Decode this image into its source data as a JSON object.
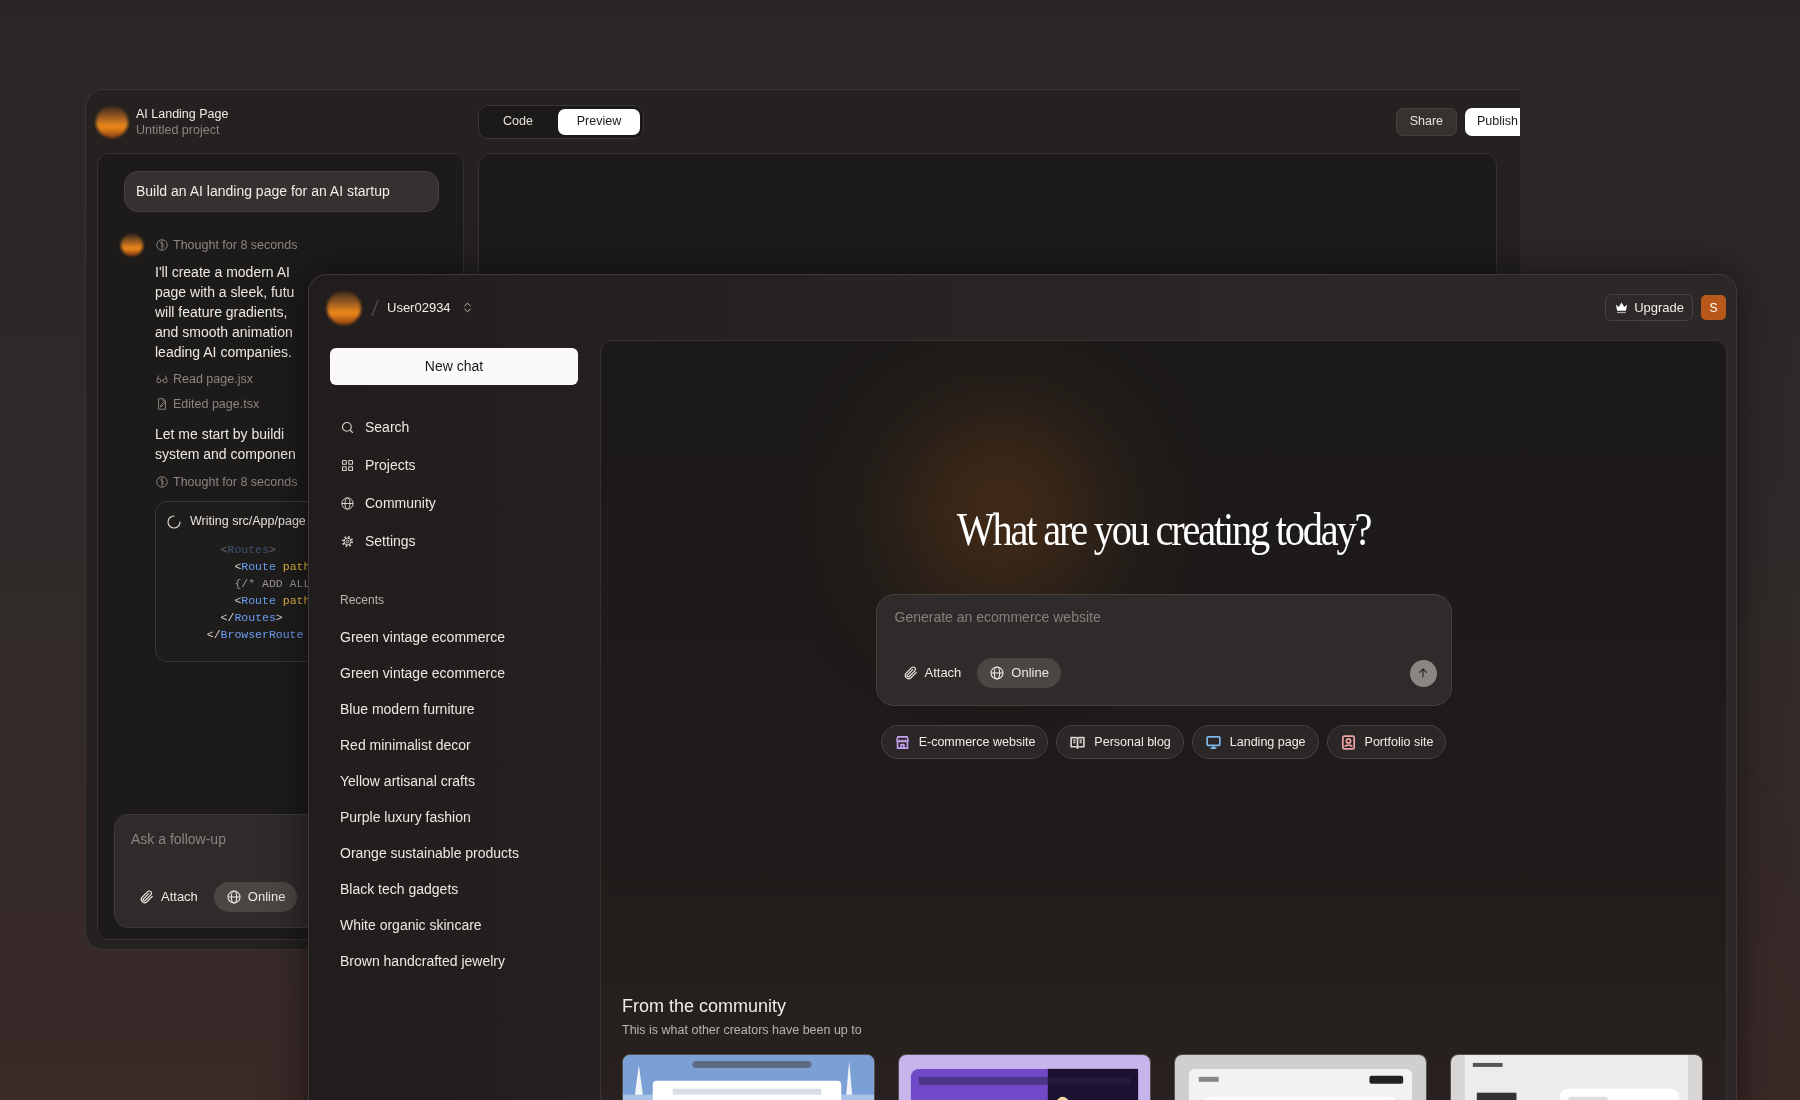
{
  "back_window": {
    "project_title": "AI Landing Page",
    "project_subtitle": "Untitled project",
    "view_tabs": [
      {
        "label": "Code",
        "selected": false
      },
      {
        "label": "Preview",
        "selected": true
      }
    ],
    "actions": [
      {
        "label": "Share",
        "kind": "secondary"
      },
      {
        "label": "Publish",
        "kind": "primary"
      }
    ],
    "chat": {
      "user_message": "Build an AI landing page for an AI startup",
      "thought_1": "Thought for 8 seconds",
      "reply_lines": [
        "I'll create a modern AI",
        "page with a sleek, futu",
        "will feature gradients,",
        "and smooth animation",
        "leading AI companies."
      ],
      "file_actions": [
        {
          "kind": "read",
          "label": "Read page.jsx"
        },
        {
          "kind": "edit",
          "label": "Edited page.tsx"
        }
      ],
      "reply_2_lines": [
        "Let me start by buildi",
        "system and componen"
      ],
      "thought_2": "Thought for 8 seconds",
      "writing": {
        "label": "Writing src/App/page",
        "code_lines": [
          [
            {
              "text": "    <",
              "kind": "punct"
            },
            {
              "text": "Routes",
              "kind": "tag"
            },
            {
              "text": ">",
              "kind": "punct"
            }
          ],
          [
            {
              "text": "      <",
              "kind": "punct"
            },
            {
              "text": "Route",
              "kind": "tag"
            },
            {
              "text": " path",
              "kind": "attr"
            }
          ],
          [
            {
              "text": "      {/* ADD ALL",
              "kind": "comment"
            }
          ],
          [
            {
              "text": "      <",
              "kind": "punct"
            },
            {
              "text": "Route",
              "kind": "tag"
            },
            {
              "text": " path",
              "kind": "attr"
            }
          ],
          [
            {
              "text": "    </",
              "kind": "punct"
            },
            {
              "text": "Routes",
              "kind": "tag"
            },
            {
              "text": ">",
              "kind": "punct"
            }
          ],
          [
            {
              "text": "  </",
              "kind": "punct"
            },
            {
              "text": "BrowserRoute",
              "kind": "tag"
            }
          ]
        ]
      }
    },
    "follow_up": {
      "placeholder": "Ask a follow-up",
      "attach": "Attach",
      "online": {
        "label": "Online",
        "on": true
      }
    }
  },
  "front_window": {
    "user": "User02934",
    "upgrade": "Upgrade",
    "avatar_initial": "S",
    "sidebar": {
      "new_chat": "New chat",
      "nav": [
        "Search",
        "Projects",
        "Community",
        "Settings"
      ],
      "recents_label": "Recents",
      "recents": [
        "Green vintage ecommerce",
        "Green vintage ecommerce",
        "Blue modern furniture",
        "Red minimalist decor",
        "Yellow artisanal crafts",
        "Purple luxury fashion",
        "Orange sustainable products",
        "Black tech gadgets",
        "White organic skincare",
        "Brown handcrafted jewelry"
      ]
    },
    "main": {
      "heading": "What are you creating today?",
      "prompt": {
        "placeholder": "Generate an ecommerce website",
        "attach": "Attach",
        "online": {
          "label": "Online",
          "on": true
        }
      },
      "suggestions": [
        {
          "label": "E-commerce website",
          "color": "#c4a3f0"
        },
        {
          "label": "Personal blog",
          "color": "#d6d3d1"
        },
        {
          "label": "Landing page",
          "color": "#7fb8e8"
        },
        {
          "label": "Portfolio site",
          "color": "#f0a3a3"
        }
      ],
      "community": {
        "title": "From the community",
        "subtitle": "This is what other creators have been up to"
      }
    }
  }
}
